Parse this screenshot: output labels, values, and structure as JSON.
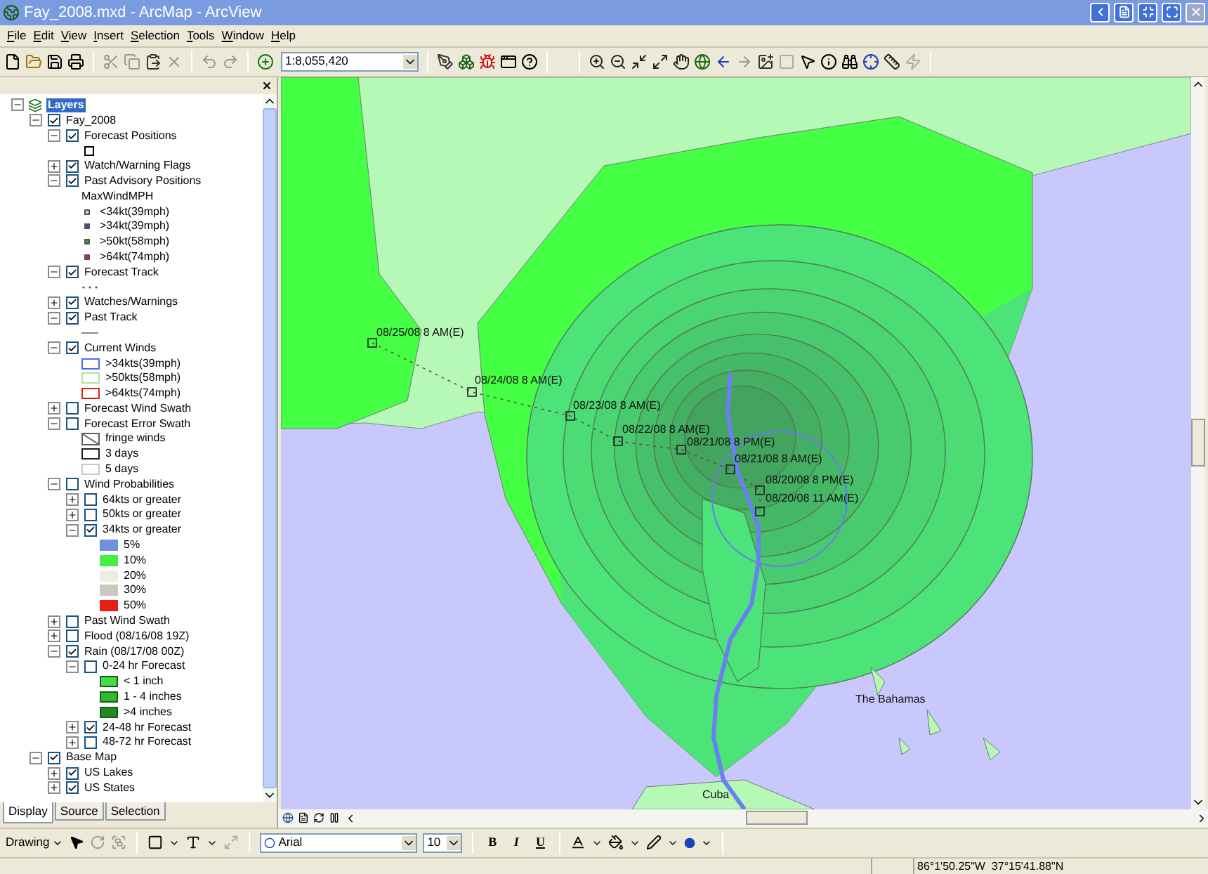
{
  "window": {
    "title": "Fay_2008.mxd - ArcMap - ArcView"
  },
  "menu": [
    "File",
    "Edit",
    "View",
    "Insert",
    "Selection",
    "Tools",
    "Window",
    "Help"
  ],
  "toolbar": {
    "scale": "1:8,055,420"
  },
  "toc": {
    "tree": [
      {
        "kind": "data-frame",
        "label": "Layers",
        "expanded": true,
        "children": [
          {
            "kind": "layer",
            "label": "Fay_2008",
            "checked": true,
            "expanded": true,
            "children": [
              {
                "kind": "layer",
                "label": "Forecast Positions",
                "checked": true,
                "expanded": true,
                "children": [
                  {
                    "kind": "square"
                  }
                ]
              },
              {
                "kind": "layer",
                "label": "Watch/Warning Flags",
                "checked": true,
                "expanded": false
              },
              {
                "kind": "layer",
                "label": "Past Advisory Positions",
                "checked": true,
                "expanded": true,
                "children": [
                  {
                    "kind": "heading",
                    "label": "MaxWindMPH"
                  },
                  {
                    "kind": "dot",
                    "color": "#d8d8d8",
                    "label": "<34kt(39mph)"
                  },
                  {
                    "kind": "dot",
                    "color": "#3050a0",
                    "label": ">34kt(39mph)"
                  },
                  {
                    "kind": "dot",
                    "color": "#30a030",
                    "label": ">50kt(58mph)"
                  },
                  {
                    "kind": "dot",
                    "color": "#e02020",
                    "label": ">64kt(74mph)"
                  }
                ]
              },
              {
                "kind": "layer",
                "label": "Forecast Track",
                "checked": true,
                "expanded": true,
                "children": [
                  {
                    "kind": "dotted-line"
                  }
                ]
              },
              {
                "kind": "layer",
                "label": "Watches/Warnings",
                "checked": true,
                "expanded": false
              },
              {
                "kind": "layer",
                "label": "Past Track",
                "checked": true,
                "expanded": true,
                "children": [
                  {
                    "kind": "line"
                  }
                ]
              },
              {
                "kind": "layer",
                "label": "Current Winds",
                "checked": true,
                "expanded": true,
                "children": [
                  {
                    "kind": "outline",
                    "color": "#4a6ee8",
                    "label": ">34kts(39mph)"
                  },
                  {
                    "kind": "outline",
                    "color": "#a8e8a0",
                    "label": ">50kts(58mph)"
                  },
                  {
                    "kind": "outline",
                    "color": "#e02010",
                    "label": ">64kts(74mph)"
                  }
                ]
              },
              {
                "kind": "layer",
                "label": "Forecast Wind Swath",
                "checked": false,
                "expanded": false
              },
              {
                "kind": "layer",
                "label": "Forecast Error Swath",
                "checked": false,
                "expanded": true,
                "children": [
                  {
                    "kind": "hatch",
                    "color": "#606060",
                    "label": "fringe winds"
                  },
                  {
                    "kind": "outline",
                    "color": "#202020",
                    "label": "3 days"
                  },
                  {
                    "kind": "outline",
                    "color": "#c8c8c8",
                    "label": "5 days"
                  }
                ]
              },
              {
                "kind": "layer",
                "label": "Wind Probabilities",
                "checked": false,
                "expanded": true,
                "children": [
                  {
                    "kind": "layer",
                    "label": "64kts or greater",
                    "checked": false,
                    "expanded": false
                  },
                  {
                    "kind": "layer",
                    "label": "50kts or greater",
                    "checked": false,
                    "expanded": false
                  },
                  {
                    "kind": "layer",
                    "label": "34kts or greater",
                    "checked": true,
                    "expanded": true,
                    "children": [
                      {
                        "kind": "fill",
                        "color": "#7090e0",
                        "label": "5%"
                      },
                      {
                        "kind": "fill",
                        "color": "#44ee44",
                        "label": "10%"
                      },
                      {
                        "kind": "fill",
                        "color": "#eeeee0",
                        "label": "20%"
                      },
                      {
                        "kind": "fill",
                        "color": "#cac8c0",
                        "label": "30%"
                      },
                      {
                        "kind": "fill",
                        "color": "#e82010",
                        "label": "50%"
                      }
                    ]
                  }
                ]
              },
              {
                "kind": "layer",
                "label": "Past Wind Swath",
                "checked": false,
                "expanded": false
              },
              {
                "kind": "layer",
                "label": "Flood (08/16/08  19Z)",
                "checked": false,
                "expanded": false
              },
              {
                "kind": "layer",
                "label": "Rain (08/17/08 00Z)",
                "checked": true,
                "expanded": true,
                "children": [
                  {
                    "kind": "layer",
                    "label": "0-24 hr Forecast",
                    "checked": false,
                    "expanded": true,
                    "children": [
                      {
                        "kind": "bordered-fill",
                        "color": "#44dd44",
                        "label": "< 1 inch"
                      },
                      {
                        "kind": "bordered-fill",
                        "color": "#2ebb2e",
                        "label": "1 - 4 inches"
                      },
                      {
                        "kind": "bordered-fill",
                        "color": "#228822",
                        "label": ">4 inches"
                      }
                    ]
                  },
                  {
                    "kind": "layer",
                    "label": "24-48 hr Forecast",
                    "checked": true,
                    "expanded": false
                  },
                  {
                    "kind": "layer",
                    "label": "48-72 hr Forecast",
                    "checked": false,
                    "expanded": false
                  }
                ]
              }
            ]
          },
          {
            "kind": "layer",
            "label": "Base Map",
            "checked": true,
            "expanded": true,
            "children": [
              {
                "kind": "layer",
                "label": "US Lakes",
                "checked": true,
                "expanded": false
              },
              {
                "kind": "layer",
                "label": "US States",
                "checked": true,
                "expanded": false
              }
            ]
          }
        ]
      }
    ],
    "tabs": [
      {
        "label": "Display",
        "selected": true
      },
      {
        "label": "Source",
        "selected": false
      },
      {
        "label": "Selection",
        "selected": false
      }
    ]
  },
  "map": {
    "track_labels": [
      "08/25/08 8 AM(E)",
      "08/24/08 8 AM(E)",
      "08/23/08 8 AM(E)",
      "08/22/08 8 AM(E)",
      "08/21/08 8 PM(E)",
      "08/21/08 8 AM(E)",
      "08/20/08 8 PM(E)",
      "08/20/08 11 AM(E)"
    ],
    "place_labels": [
      "The Bahamas",
      "Cuba"
    ]
  },
  "drawing_toolbar": {
    "menu": "Drawing",
    "font": "Arial",
    "size": "10",
    "styles": [
      "B",
      "I",
      "U"
    ]
  },
  "status_bar": {
    "coordinates": "86°1'50.25\"W  37°15'41.88\"N"
  }
}
